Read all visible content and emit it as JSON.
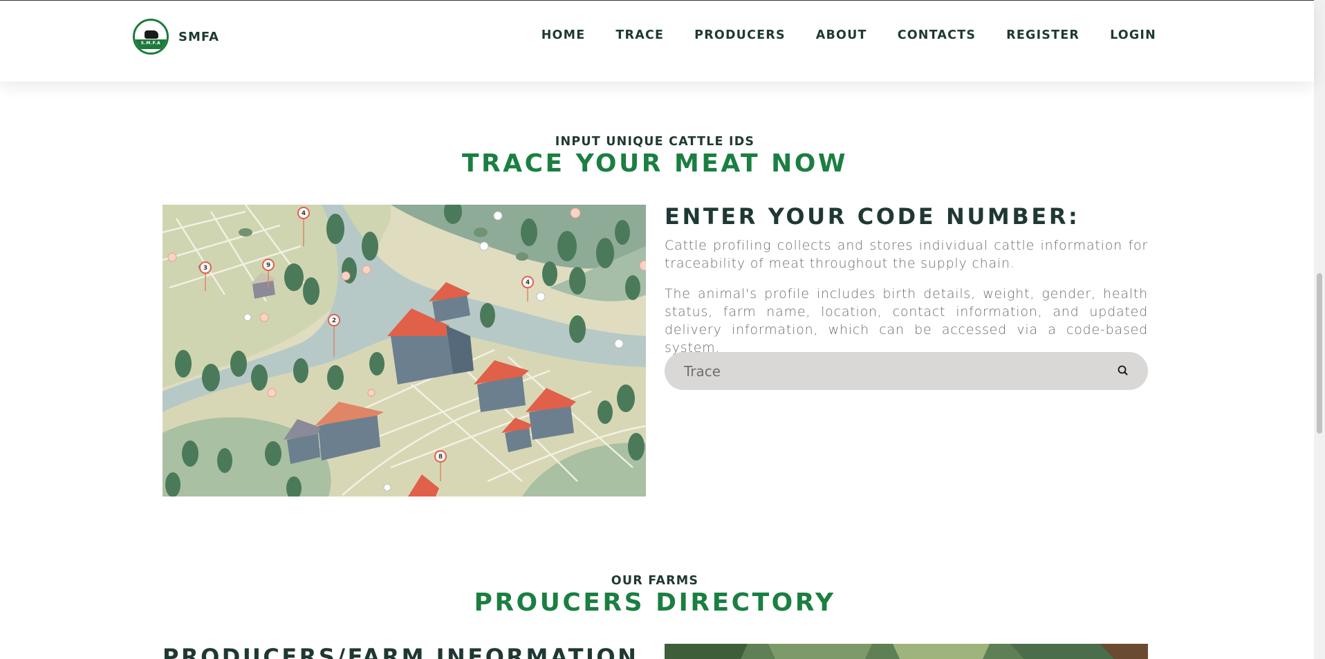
{
  "brand": {
    "name": "SMFA",
    "logo_text": "S.M.F.A"
  },
  "nav": {
    "items": [
      "HOME",
      "TRACE",
      "PRODUCERS",
      "ABOUT",
      "CONTACTS",
      "REGISTER",
      "LOGIN"
    ]
  },
  "trace_section": {
    "eyebrow": "INPUT UNIQUE CATTLE IDS",
    "title": "TRACE YOUR MEAT NOW",
    "code_heading": "ENTER YOUR CODE NUMBER:",
    "paragraph_1": "Cattle profiling collects and stores individual cattle information for traceability of meat throughout the supply chain.",
    "paragraph_2": "The animal's profile includes birth details, weight, gender, health status, farm name, location, contact information, and updated delivery information, which can be accessed via a code-based system.",
    "search": {
      "placeholder": "Trace",
      "value": "",
      "icon": "search-icon"
    },
    "map_pins": [
      "4",
      "3",
      "9",
      "2",
      "4",
      "8"
    ]
  },
  "producers_section": {
    "eyebrow": "OUR FARMS",
    "title": "PROUCERS DIRECTORY",
    "heading": "PRODUCERS/FARM INFORMATION"
  },
  "colors": {
    "accent_green": "#1a7f41",
    "heading_dark": "#1f3833",
    "body_text": "#6b6b6b",
    "search_bg": "#d9d8d6",
    "roof_red": "#e0604a"
  }
}
